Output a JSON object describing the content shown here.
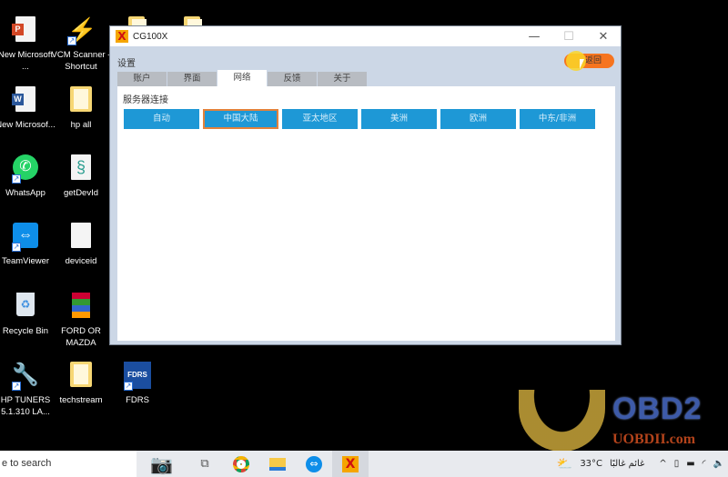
{
  "desktop": {
    "icons": [
      {
        "label": "New Microsoft ...",
        "icon": "powerpoint-icon"
      },
      {
        "label": "VCM Scanner - Shortcut",
        "icon": "lightning-icon"
      },
      {
        "label": "New Microsof...",
        "icon": "word-icon"
      },
      {
        "label": "hp all",
        "icon": "folder-icon"
      },
      {
        "label": "WhatsApp",
        "icon": "whatsapp-icon"
      },
      {
        "label": "getDevId",
        "icon": "script-icon"
      },
      {
        "label": "TeamViewer",
        "icon": "teamviewer-icon"
      },
      {
        "label": "deviceid",
        "icon": "file-icon"
      },
      {
        "label": "Recycle Bin",
        "icon": "recycle-bin-icon"
      },
      {
        "label": "FORD OR MAZDA",
        "icon": "archive-icon"
      },
      {
        "label": "HP TUNERS 5.1.310 LA...",
        "icon": "wrench-icon"
      },
      {
        "label": "techstream",
        "icon": "folder-icon"
      },
      {
        "label": "FDRS",
        "icon": "fdrs-icon"
      }
    ]
  },
  "window": {
    "title": "CG100X",
    "app_icon_glyph": "X",
    "controls": {
      "minimize": "—",
      "maximize": "☐",
      "close": "✕"
    },
    "settings_label": "设置",
    "back_button": "返回",
    "tabs": [
      {
        "label": "账户",
        "active": false
      },
      {
        "label": "界面",
        "active": false
      },
      {
        "label": "网络",
        "active": true
      },
      {
        "label": "反馈",
        "active": false
      },
      {
        "label": "关于",
        "active": false
      }
    ],
    "section_title": "服务器连接",
    "servers": [
      {
        "label": "自动",
        "selected": false
      },
      {
        "label": "中国大陆",
        "selected": true
      },
      {
        "label": "亚太地区",
        "selected": false
      },
      {
        "label": "美洲",
        "selected": false
      },
      {
        "label": "欧洲",
        "selected": false
      },
      {
        "label": "中东/非洲",
        "selected": false
      }
    ]
  },
  "taskbar": {
    "search_placeholder": "e to search",
    "weather_temp": "33°C",
    "weather_text": "غائم غالبًا",
    "tray_chevron": "^"
  },
  "watermark": {
    "brand": "OBD2",
    "url": "UOBDII.com"
  },
  "colors": {
    "accent_blue": "#1e98d6",
    "selected_border": "#e2813b",
    "back_button": "#f6741f"
  }
}
